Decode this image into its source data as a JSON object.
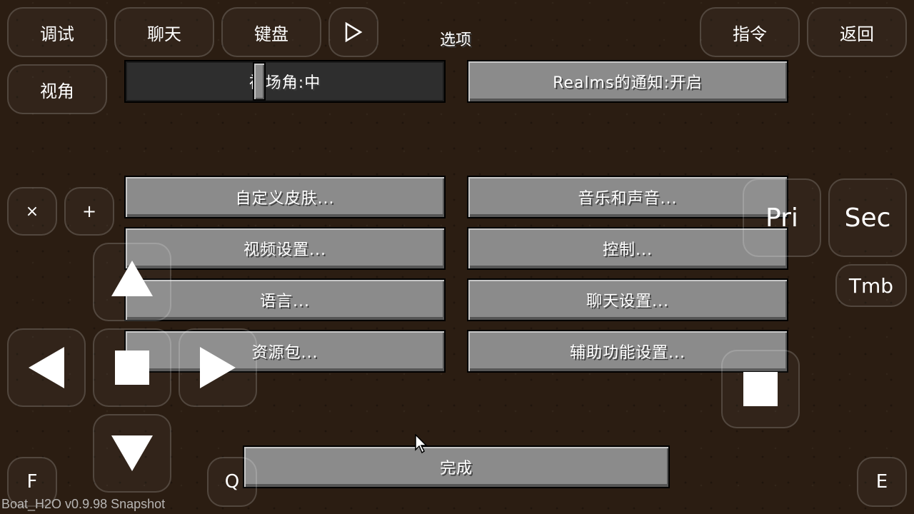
{
  "screen": {
    "title": "选项",
    "fov_slider": {
      "label": "视场角:中",
      "value_fraction": 0.42
    },
    "realms_button": "Realms的通知:开启",
    "buttons_left": [
      "自定义皮肤...",
      "视频设置...",
      "语言...",
      "资源包..."
    ],
    "buttons_right": [
      "音乐和声音...",
      "控制...",
      "聊天设置...",
      "辅助功能设置..."
    ],
    "done_button": "完成"
  },
  "overlay": {
    "debug": "调试",
    "chat": "聊天",
    "keyboard": "键盘",
    "command": "指令",
    "back": "返回",
    "view": "视角",
    "close_symbol": "×",
    "plus_symbol": "+",
    "primary": "Pri",
    "secondary": "Sec",
    "thumb": "Tmb",
    "key_f": "F",
    "key_q": "Q",
    "key_e": "E"
  },
  "icons": {
    "play": "play-icon",
    "up": "arrow-up-icon",
    "down": "arrow-down-icon",
    "left": "arrow-left-icon",
    "right": "arrow-right-icon",
    "sneak": "square-icon",
    "jump": "square-icon"
  },
  "footer": {
    "version": "Boat_H2O v0.9.98 Snapshot"
  }
}
